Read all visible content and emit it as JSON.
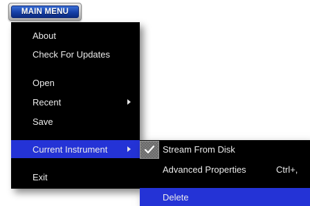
{
  "main_menu_button": {
    "label": "MAIN MENU"
  },
  "menu": {
    "items": [
      {
        "label": "About"
      },
      {
        "label": "Check For Updates"
      },
      {
        "label": "Open"
      },
      {
        "label": "Recent"
      },
      {
        "label": "Save"
      },
      {
        "label": "Current Instrument"
      },
      {
        "label": "Exit"
      }
    ]
  },
  "submenu": {
    "items": [
      {
        "label": "Stream From Disk",
        "checked": true
      },
      {
        "label": "Advanced Properties",
        "shortcut": "Ctrl+,"
      },
      {
        "label": "Delete"
      }
    ]
  },
  "colors": {
    "menu_background": "#000000",
    "highlight": "#2433d6",
    "text": "#ececec",
    "button_blue": "#1640a8"
  },
  "icons": {
    "submenu_arrow": "right-triangle",
    "checkmark": "check-mark"
  }
}
